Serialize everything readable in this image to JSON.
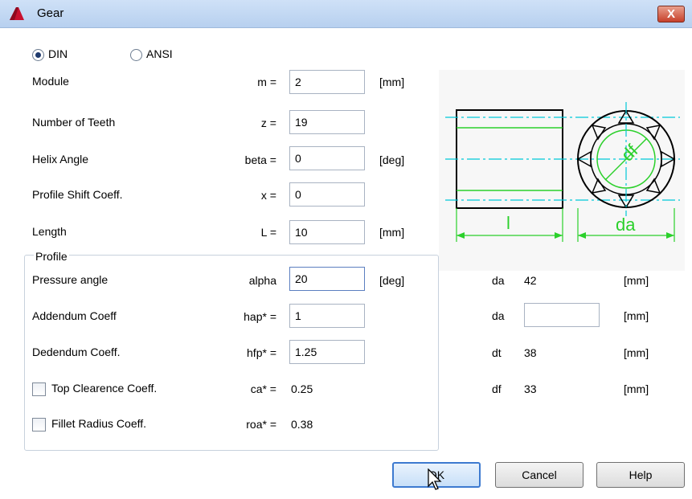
{
  "window": {
    "title": "Gear",
    "close_label": "X"
  },
  "standard": {
    "options": [
      {
        "label": "DIN",
        "checked": true
      },
      {
        "label": "ANSI",
        "checked": false
      }
    ]
  },
  "params": [
    {
      "label": "Module",
      "symbol": "m =",
      "value": "2",
      "unit": "[mm]"
    },
    {
      "label": "Number of Teeth",
      "symbol": "z =",
      "value": "19",
      "unit": ""
    },
    {
      "label": "Helix Angle",
      "symbol": "beta =",
      "value": "0",
      "unit": "[deg]"
    },
    {
      "label": "Profile Shift Coeff.",
      "symbol": "x =",
      "value": "0",
      "unit": ""
    },
    {
      "label": "Length",
      "symbol": "L =",
      "value": "10",
      "unit": "[mm]"
    }
  ],
  "profile": {
    "group_label": "Profile",
    "rows": [
      {
        "label": "Pressure angle",
        "symbol": "alpha",
        "value": "20",
        "unit": "[deg]"
      },
      {
        "label": "Addendum Coeff",
        "symbol": "hap* =",
        "value": "1",
        "unit": ""
      },
      {
        "label": "Dedendum Coeff.",
        "symbol": "hfp* =",
        "value": "1.25",
        "unit": ""
      }
    ],
    "checks": [
      {
        "label": "Top Clearence Coeff.",
        "symbol": "ca* =",
        "value": "0.25",
        "checked": false
      },
      {
        "label": "Fillet Radius Coeff.",
        "symbol": "roa* =",
        "value": "0.38",
        "checked": false
      }
    ]
  },
  "results": [
    {
      "symbol": "da",
      "value": "42",
      "unit": "[mm]",
      "editable": false
    },
    {
      "symbol": "da",
      "value": "",
      "unit": "[mm]",
      "editable": true
    },
    {
      "symbol": "dt",
      "value": "38",
      "unit": "[mm]",
      "editable": false
    },
    {
      "symbol": "df",
      "value": "33",
      "unit": "[mm]",
      "editable": false
    }
  ],
  "drawing": {
    "length_label": "l",
    "da_label": "da",
    "df_label": "df"
  },
  "buttons": {
    "ok": "OK",
    "cancel": "Cancel",
    "help": "Help"
  },
  "colors": {
    "accent": "#3d7ad0",
    "drawing_line": "#00c8d8",
    "dimension": "#2bd02b",
    "title_bar": "#b7d0ef"
  }
}
